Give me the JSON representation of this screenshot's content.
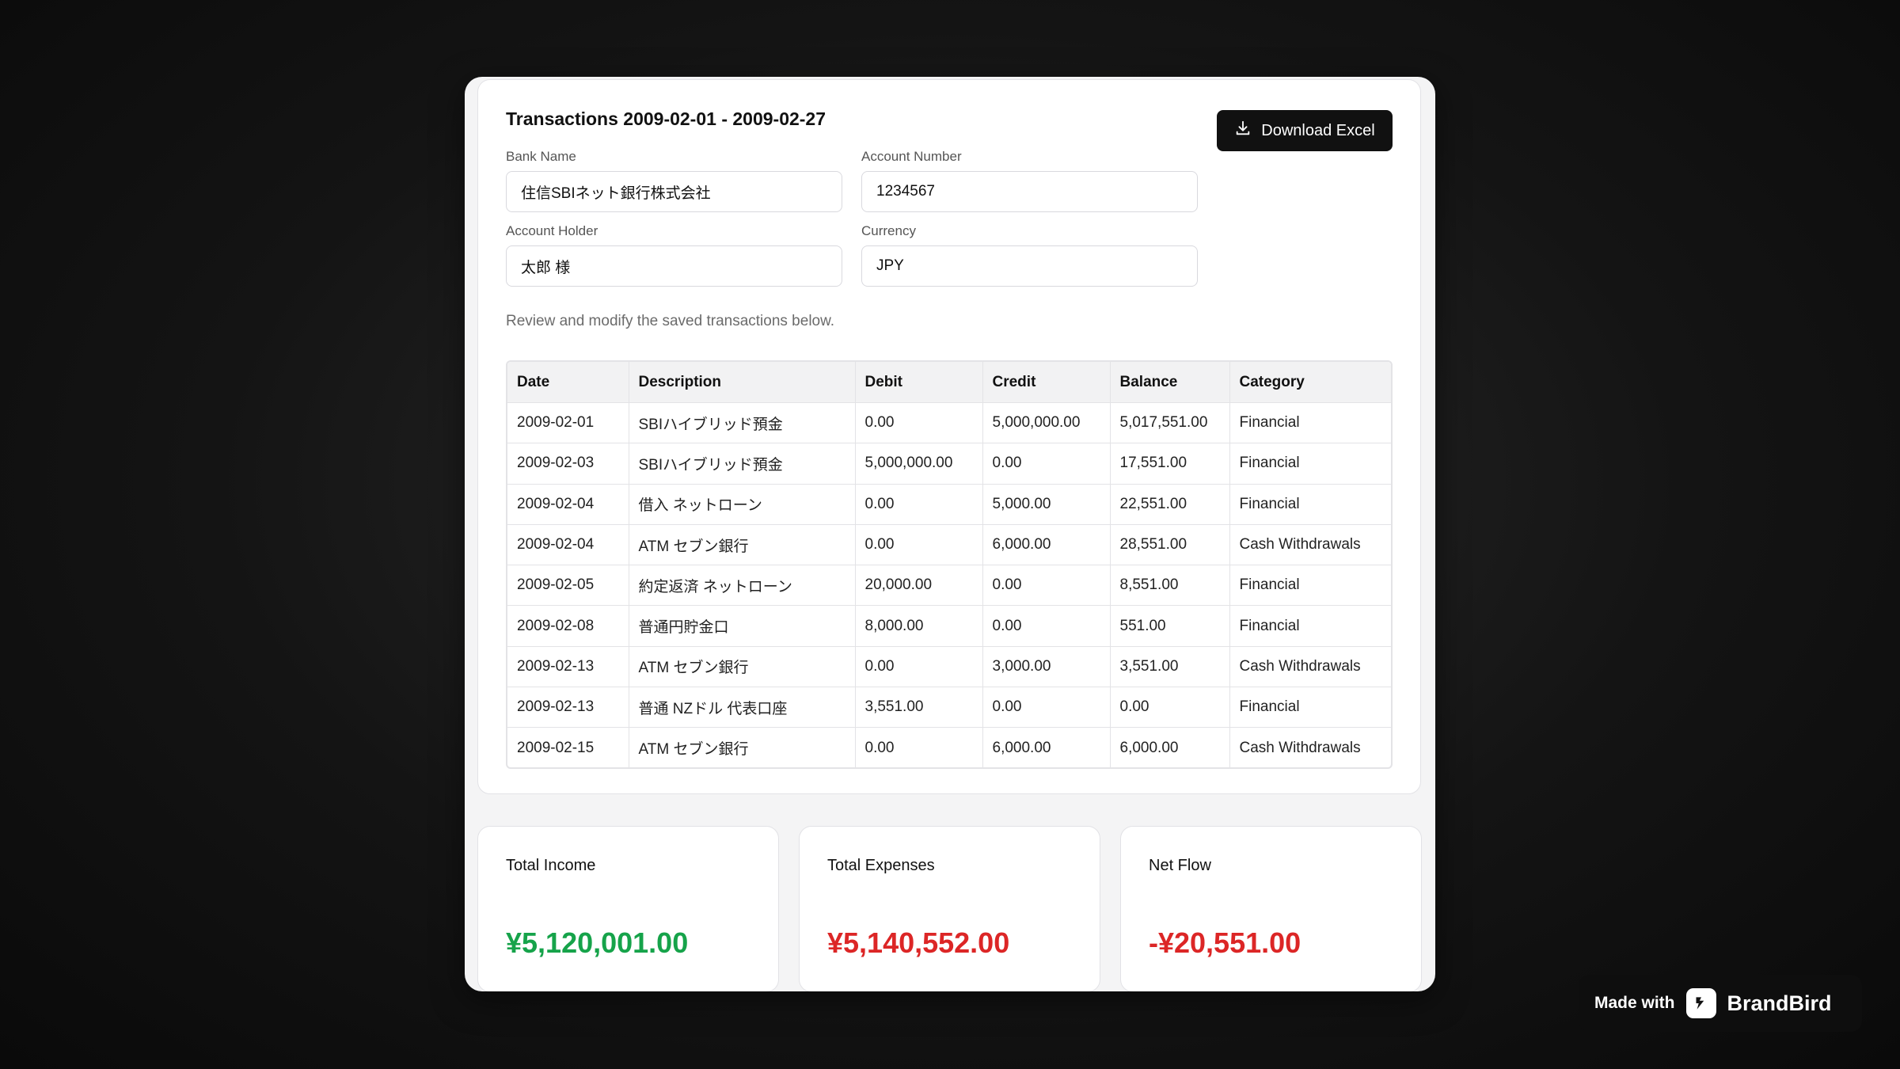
{
  "card": {
    "title": "Transactions 2009-02-01 - 2009-02-27",
    "download_label": "Download Excel",
    "fields": {
      "bank_name": {
        "label": "Bank Name",
        "value": "住信SBIネット銀行株式会社"
      },
      "account_number": {
        "label": "Account Number",
        "value": "1234567"
      },
      "account_holder": {
        "label": "Account Holder",
        "value": "太郎 様"
      },
      "currency": {
        "label": "Currency",
        "value": "JPY"
      }
    },
    "hint": "Review and modify the saved transactions below."
  },
  "table": {
    "headers": [
      "Date",
      "Description",
      "Debit",
      "Credit",
      "Balance",
      "Category"
    ],
    "rows": [
      [
        "2009-02-01",
        "SBIハイブリッド預金",
        "0.00",
        "5,000,000.00",
        "5,017,551.00",
        "Financial"
      ],
      [
        "2009-02-03",
        "SBIハイブリッド預金",
        "5,000,000.00",
        "0.00",
        "17,551.00",
        "Financial"
      ],
      [
        "2009-02-04",
        "借入 ネットローン",
        "0.00",
        "5,000.00",
        "22,551.00",
        "Financial"
      ],
      [
        "2009-02-04",
        "ATM セブン銀行",
        "0.00",
        "6,000.00",
        "28,551.00",
        "Cash Withdrawals"
      ],
      [
        "2009-02-05",
        "約定返済 ネットローン",
        "20,000.00",
        "0.00",
        "8,551.00",
        "Financial"
      ],
      [
        "2009-02-08",
        "普通円貯金口",
        "8,000.00",
        "0.00",
        "551.00",
        "Financial"
      ],
      [
        "2009-02-13",
        "ATM セブン銀行",
        "0.00",
        "3,000.00",
        "3,551.00",
        "Cash Withdrawals"
      ],
      [
        "2009-02-13",
        "普通 NZドル 代表口座",
        "3,551.00",
        "0.00",
        "0.00",
        "Financial"
      ],
      [
        "2009-02-15",
        "ATM セブン銀行",
        "0.00",
        "6,000.00",
        "6,000.00",
        "Cash Withdrawals"
      ]
    ]
  },
  "stats": {
    "income": {
      "label": "Total Income",
      "value": "¥5,120,001.00",
      "color": "#16a34a"
    },
    "expenses": {
      "label": "Total Expenses",
      "value": "¥5,140,552.00",
      "color": "#dc2626"
    },
    "net": {
      "label": "Net Flow",
      "value": "-¥20,551.00",
      "color": "#dc2626"
    }
  },
  "badge": {
    "made_with": "Made with",
    "brand": "BrandBird"
  },
  "icons": {
    "download": "download-icon",
    "brand_logo": "brandbird-logo-icon"
  }
}
